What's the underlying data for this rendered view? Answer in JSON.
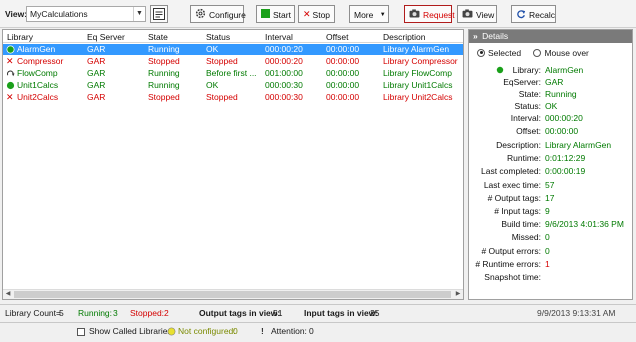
{
  "toolbar": {
    "view_label": "View:",
    "view_value": "MyCalculations",
    "buttons": {
      "configure": "Configure",
      "start": "Start",
      "stop": "Stop",
      "more": "More",
      "request": "Request",
      "view": "View",
      "recalc": "Recalc"
    }
  },
  "grid": {
    "columns": {
      "library": "Library",
      "eq_server": "Eq Server",
      "state": "State",
      "status": "Status",
      "interval": "Interval",
      "offset": "Offset",
      "description": "Description"
    },
    "rows": [
      {
        "library": "AlarmGen",
        "eq_server": "GAR",
        "state": "Running",
        "status": "OK",
        "interval": "000:00:20",
        "offset": "00:00:00",
        "description": "Library AlarmGen",
        "icon": "running-dot-icon"
      },
      {
        "library": "Compressor",
        "eq_server": "GAR",
        "state": "Stopped",
        "status": "Stopped",
        "interval": "000:00:20",
        "offset": "00:00:00",
        "description": "Library Compressor",
        "icon": "stopped-x-icon"
      },
      {
        "library": "FlowComp",
        "eq_server": "GAR",
        "state": "Running",
        "status": "Before first ...",
        "interval": "001:00:00",
        "offset": "00:00:00",
        "description": "Library FlowComp",
        "icon": "pending-arrow-icon"
      },
      {
        "library": "Unit1Calcs",
        "eq_server": "GAR",
        "state": "Running",
        "status": "OK",
        "interval": "000:00:30",
        "offset": "00:00:00",
        "description": "Library Unit1Calcs",
        "icon": "running-dot-icon"
      },
      {
        "library": "Unit2Calcs",
        "eq_server": "GAR",
        "state": "Stopped",
        "status": "Stopped",
        "interval": "000:00:30",
        "offset": "00:00:00",
        "description": "Library Unit2Calcs",
        "icon": "stopped-x-icon"
      }
    ]
  },
  "details": {
    "header": "Details",
    "radio_selected": "Selected",
    "radio_mouse_over": "Mouse over",
    "fields": [
      {
        "key": "Library:",
        "value": "AlarmGen"
      },
      {
        "key": "EqServer:",
        "value": "GAR"
      },
      {
        "key": "State:",
        "value": "Running"
      },
      {
        "key": "Status:",
        "value": "OK"
      },
      {
        "key": "Interval:",
        "value": "000:00:20"
      },
      {
        "key": "Offset:",
        "value": "00:00:00"
      },
      {
        "key": "Description:",
        "value": "Library AlarmGen"
      },
      {
        "key": "Runtime:",
        "value": "0:01:12:29"
      },
      {
        "key": "Last completed:",
        "value": "0:00:00:19"
      },
      {
        "key": "Last exec time:",
        "value": "57"
      },
      {
        "key": "# Output tags:",
        "value": "17"
      },
      {
        "key": "# Input tags:",
        "value": "9"
      },
      {
        "key": "Build time:",
        "value": "9/6/2013 4:01:36 PM"
      },
      {
        "key": "Missed:",
        "value": "0"
      },
      {
        "key": "# Output errors:",
        "value": "0"
      },
      {
        "key": "# Runtime errors:",
        "value": "1"
      },
      {
        "key": "Snapshot time:",
        "value": ""
      }
    ]
  },
  "status_bar": {
    "library_count_label": "Library Count=",
    "library_count": "5",
    "running_label": "Running:",
    "running": "3",
    "stopped_label": "Stopped:",
    "stopped": "2",
    "output_tags_label": "Output tags in view:",
    "output_tags": "51",
    "input_tags_label": "Input tags in view:",
    "input_tags": "25",
    "timestamp": "9/9/2013 9:13:31 AM"
  },
  "footer": {
    "show_called_libraries": "Show Called Libraries",
    "not_configured_label": "Not configured:",
    "not_configured": "0",
    "attention_label": "Attention:",
    "attention": "0"
  },
  "colors": {
    "running": "#007a00",
    "stopped": "#d40000",
    "selected_row": "#3399ff",
    "details_header": "#7a7a7a",
    "not_configured": "#7a8a00"
  }
}
